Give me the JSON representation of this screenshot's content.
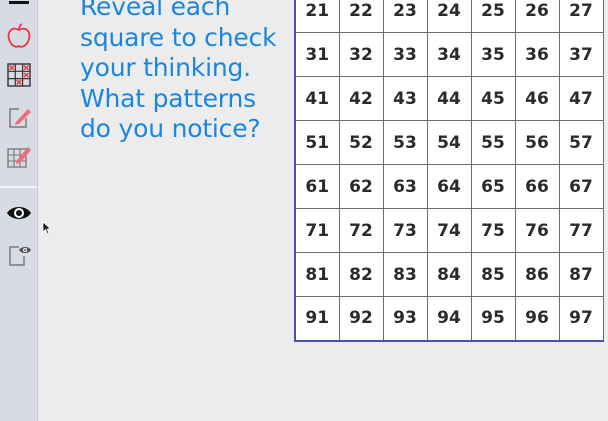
{
  "prompt": {
    "lines": [
      "Reveal each",
      "square to check",
      "your thinking.",
      "What patterns",
      "do you notice?"
    ]
  },
  "sidebar": {
    "tools": [
      {
        "icon": "menu-icon"
      },
      {
        "icon": "apple-icon"
      },
      {
        "icon": "grid-reveal-icon"
      },
      {
        "icon": "pencil-note-icon"
      },
      {
        "icon": "grid-pencil-icon"
      },
      {
        "icon": "eye-icon"
      },
      {
        "icon": "note-eye-icon"
      }
    ]
  },
  "grid": {
    "rows": [
      [
        "21",
        "22",
        "23",
        "24",
        "25",
        "26",
        "27"
      ],
      [
        "31",
        "32",
        "33",
        "34",
        "35",
        "36",
        "37"
      ],
      [
        "41",
        "42",
        "43",
        "44",
        "45",
        "46",
        "47"
      ],
      [
        "51",
        "52",
        "53",
        "54",
        "55",
        "56",
        "57"
      ],
      [
        "61",
        "62",
        "63",
        "64",
        "65",
        "66",
        "67"
      ],
      [
        "71",
        "72",
        "73",
        "74",
        "75",
        "76",
        "77"
      ],
      [
        "81",
        "82",
        "83",
        "84",
        "85",
        "86",
        "87"
      ],
      [
        "91",
        "92",
        "93",
        "94",
        "95",
        "96",
        "97"
      ]
    ]
  },
  "colors": {
    "prompt_text": "#1a86e0",
    "grid_border": "#4b4fa5",
    "sidebar_bg": "#d8dbe3"
  }
}
